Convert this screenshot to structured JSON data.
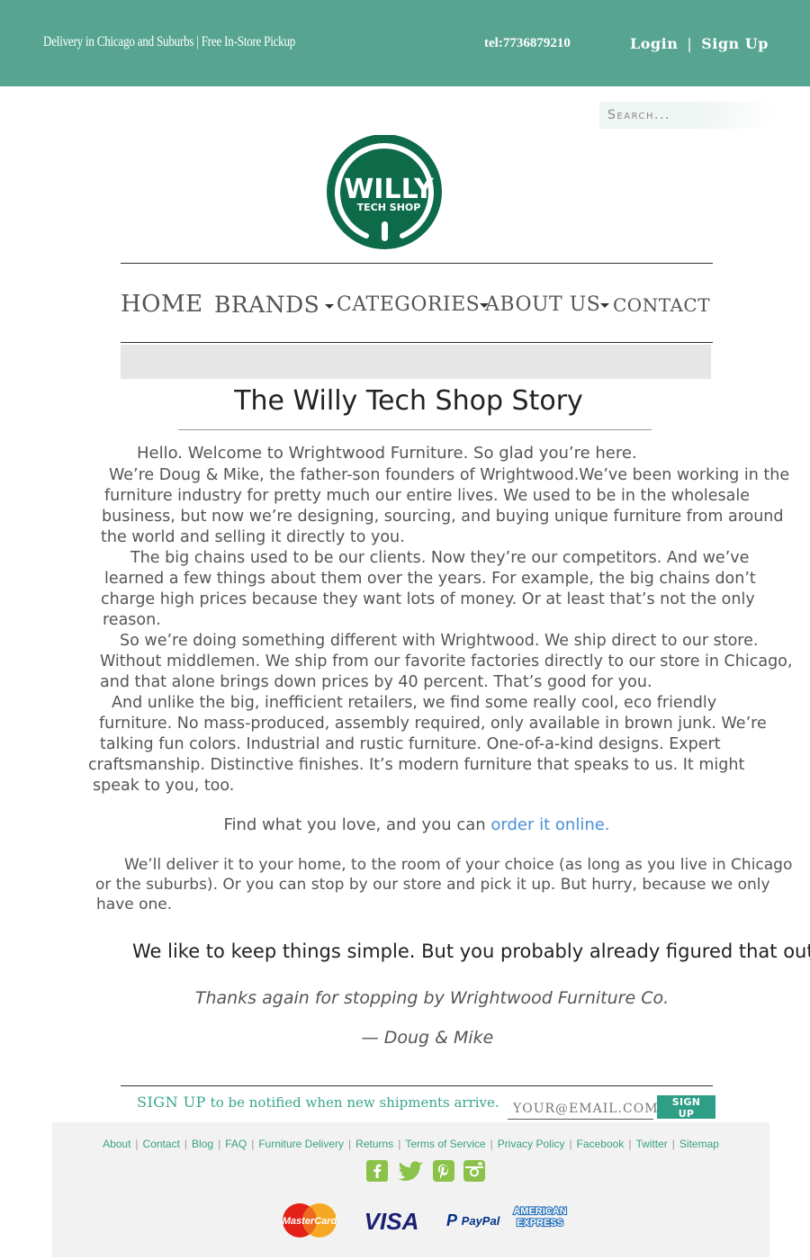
{
  "topbar": {
    "delivery": "Delivery in Chicago and Suburbs | Free In-Store Pickup",
    "phone": "tel:7736879210",
    "login": "Login",
    "separator": "|",
    "signup": "Sign Up",
    "bg_color": "#57a591"
  },
  "search": {
    "placeholder": "Search..."
  },
  "logo": {
    "line1": "WILLY",
    "line2": "TECH SHOP",
    "color": "#0e6b4a"
  },
  "nav": {
    "items": [
      {
        "label": "HOME",
        "has_dropdown": false
      },
      {
        "label": "BRANDS",
        "has_dropdown": true
      },
      {
        "label": "CATEGORIES",
        "has_dropdown": true
      },
      {
        "label": "ABOUT US",
        "has_dropdown": true
      },
      {
        "label": "CONTACT",
        "has_dropdown": false
      }
    ]
  },
  "story": {
    "title": "The Willy Tech Shop Story",
    "lines": [
      "Hello. Welcome to Wrightwood Furniture. So glad you’re here.",
      "We’re Doug & Mike, the father-son founders of Wrightwood.We’ve been working in the",
      "furniture industry for pretty much our entire lives. We used to be in the wholesale",
      "business, but now we’re designing, sourcing, and buying unique furniture from around",
      "the world and selling it directly to you.",
      "The big chains used to be our clients. Now they’re our competitors.  And we’ve",
      "learned a few things about them over the years.  For example, the big chains don’t",
      "charge high prices because they want lots of money. Or at least that’s not the only",
      "reason.",
      "So we’re doing something different with Wrightwood. We ship direct to our store.",
      "Without middlemen. We ship from our favorite factories directly to our store in Chicago,",
      "and that alone brings down prices by 40 percent. That’s good for you.",
      "And unlike the big, inefficient retailers, we find some really cool, eco friendly",
      "furniture. No mass-produced, assembly required, only available in brown junk. We’re",
      "talking fun colors. Industrial and rustic furniture. One-of-a-kind designs. Expert",
      "craftsmanship. Distinctive finishes. It’s modern furniture that speaks to us. It might",
      "speak to you, too."
    ],
    "find_text": "Find what you love, and you can ",
    "find_link": "order it online.",
    "deliver_lines": [
      "We’ll deliver it to your home, to the room of your choice (as long as you live in Chicago",
      "or the suburbs). Or you can stop by our store and pick it up. But hurry, because we only",
      "have one."
    ],
    "simple": "We like to keep things simple. But you probably already figured that out.",
    "thanks": "Thanks again for stopping by Wrightwood Furniture Co.",
    "signature": "— Doug & Mike"
  },
  "newsletter": {
    "label_strong": "SIGN UP",
    "label_rest": " to be notified when new shipments arrive.",
    "placeholder": "YOUR@EMAIL.COM",
    "button": "SIGN UP"
  },
  "footer": {
    "links": [
      "About",
      "Contact",
      "Blog",
      "FAQ",
      "Furniture Delivery",
      "Returns",
      "Terms of Service",
      "Privacy Policy",
      "Facebook",
      "Twitter",
      "Sitemap"
    ],
    "social": [
      "facebook-icon",
      "twitter-icon",
      "pinterest-icon",
      "instagram-icon"
    ],
    "payments": {
      "mastercard": "MasterCard",
      "visa": "VISA",
      "paypal": "PayPal",
      "amex_line1": "AMERICAN",
      "amex_line2": "EXPRESS"
    },
    "accent": "#3a9e86"
  }
}
